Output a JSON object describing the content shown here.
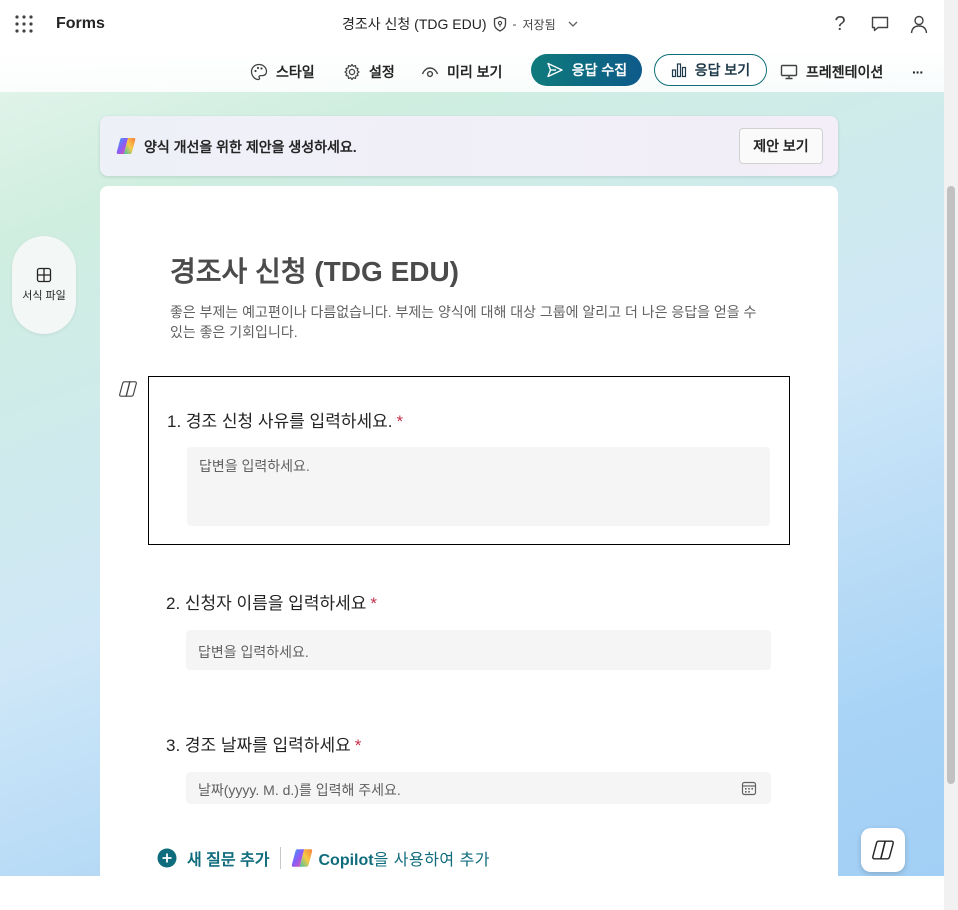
{
  "app": {
    "name": "Forms"
  },
  "header": {
    "doc_title": "경조사 신청 (TDG EDU)",
    "separator": "-",
    "save_status": "저장됨",
    "help_glyph": "?"
  },
  "toolbar": {
    "style_label": "스타일",
    "settings_label": "설정",
    "preview_label": "미리 보기",
    "collect_label": "응답 수집",
    "responses_label": "응답 보기",
    "present_label": "프레젠테이션",
    "more_glyph": "···"
  },
  "banner": {
    "text": "양식 개선을 위한 제안을 생성하세요.",
    "button_label": "제안 보기"
  },
  "side": {
    "label": "서식 파일"
  },
  "form": {
    "title": "경조사 신청 (TDG EDU)",
    "description": "좋은 부제는 예고편이나 다름없습니다. 부제는 양식에 대해 대상 그룹에 알리고 더 나은 응답을 얻을 수 있는 좋은 기회입니다.",
    "questions": [
      {
        "label": "1. 경조 신청 사유를 입력하세요.",
        "required": "*",
        "placeholder": "답변을 입력하세요."
      },
      {
        "label": "2. 신청자 이름을 입력하세요",
        "required": "*",
        "placeholder": "답변을 입력하세요."
      },
      {
        "label": "3. 경조 날짜를 입력하세요",
        "required": "*",
        "placeholder": "날짜(yyyy. M. d.)를 입력해 주세요."
      }
    ],
    "add_question_label": "새 질문 추가",
    "add_copilot_brand": "Copilot",
    "add_copilot_suffix": "을 사용하여 추가"
  },
  "colors": {
    "accent": "#0f6c7c",
    "collect_gradient_start": "#0f7b7b",
    "collect_gradient_end": "#0e5a8a",
    "required_star": "#c4314b"
  },
  "icons": {
    "waffle": "waffle-icon",
    "shield": "shield-icon",
    "chevron": "chevron-down-icon",
    "help": "help-icon",
    "comment": "comment-icon",
    "person": "person-icon",
    "palette": "palette-icon",
    "gear": "gear-icon",
    "eye": "eye-icon",
    "send": "send-icon",
    "chart": "chart-icon",
    "presentation": "presentation-icon",
    "more": "more-icon",
    "copilot": "copilot-icon",
    "template": "template-icon",
    "calendar": "calendar-icon",
    "plus": "plus-circle-icon"
  }
}
